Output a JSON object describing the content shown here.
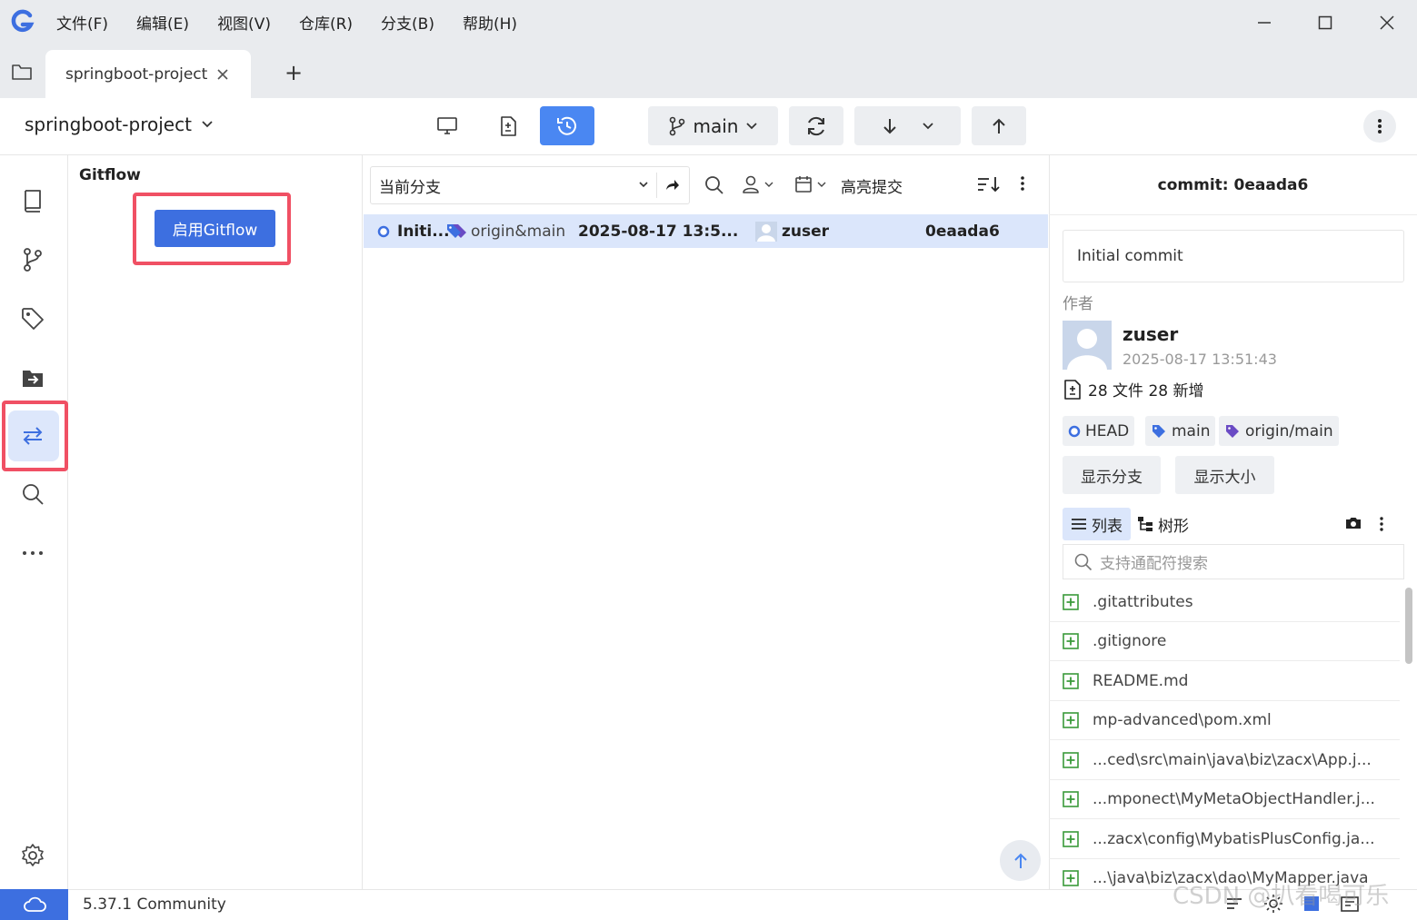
{
  "app": {
    "menu": [
      "文件(F)",
      "编辑(E)",
      "视图(V)",
      "仓库(R)",
      "分支(B)",
      "帮助(H)"
    ],
    "accent_color": "#3d6fe0"
  },
  "tabs": {
    "active_label": "springboot-project",
    "add_label": "+"
  },
  "toolbar": {
    "repo_name": "springboot-project",
    "branch": "main"
  },
  "gitflow": {
    "title": "Gitflow",
    "enable_button": "启用Gitflow"
  },
  "commit_list": {
    "filter_value": "当前分支",
    "highlight_label": "高亮提交",
    "rows": [
      {
        "message": "Initi...",
        "refs": "origin&main",
        "date": "2025-08-17 13:5...",
        "author": "zuser",
        "hash": "0eaada6"
      }
    ]
  },
  "detail": {
    "header": "commit: 0eaada6",
    "message": "Initial commit",
    "author_label": "作者",
    "author_name": "zuser",
    "author_date": "2025-08-17 13:51:43",
    "file_stats": "28 文件 28 新增",
    "refs": [
      "HEAD",
      "main",
      "origin/main"
    ],
    "buttons": [
      "显示分支",
      "显示大小"
    ],
    "view_list_label": "列表",
    "view_tree_label": "树形",
    "search_placeholder": "支持通配符搜索",
    "files": [
      ".gitattributes",
      ".gitignore",
      "README.md",
      "mp-advanced\\pom.xml",
      "...ced\\src\\main\\java\\biz\\zacx\\App.j...",
      "...mponect\\MyMetaObjectHandler.j...",
      "...zacx\\config\\MybatisPlusConfig.ja...",
      "...\\java\\biz\\zacx\\dao\\MyMapper.java"
    ]
  },
  "status": {
    "version": "5.37.1 Community"
  },
  "watermark": "CSDN @扒看喝可乐"
}
